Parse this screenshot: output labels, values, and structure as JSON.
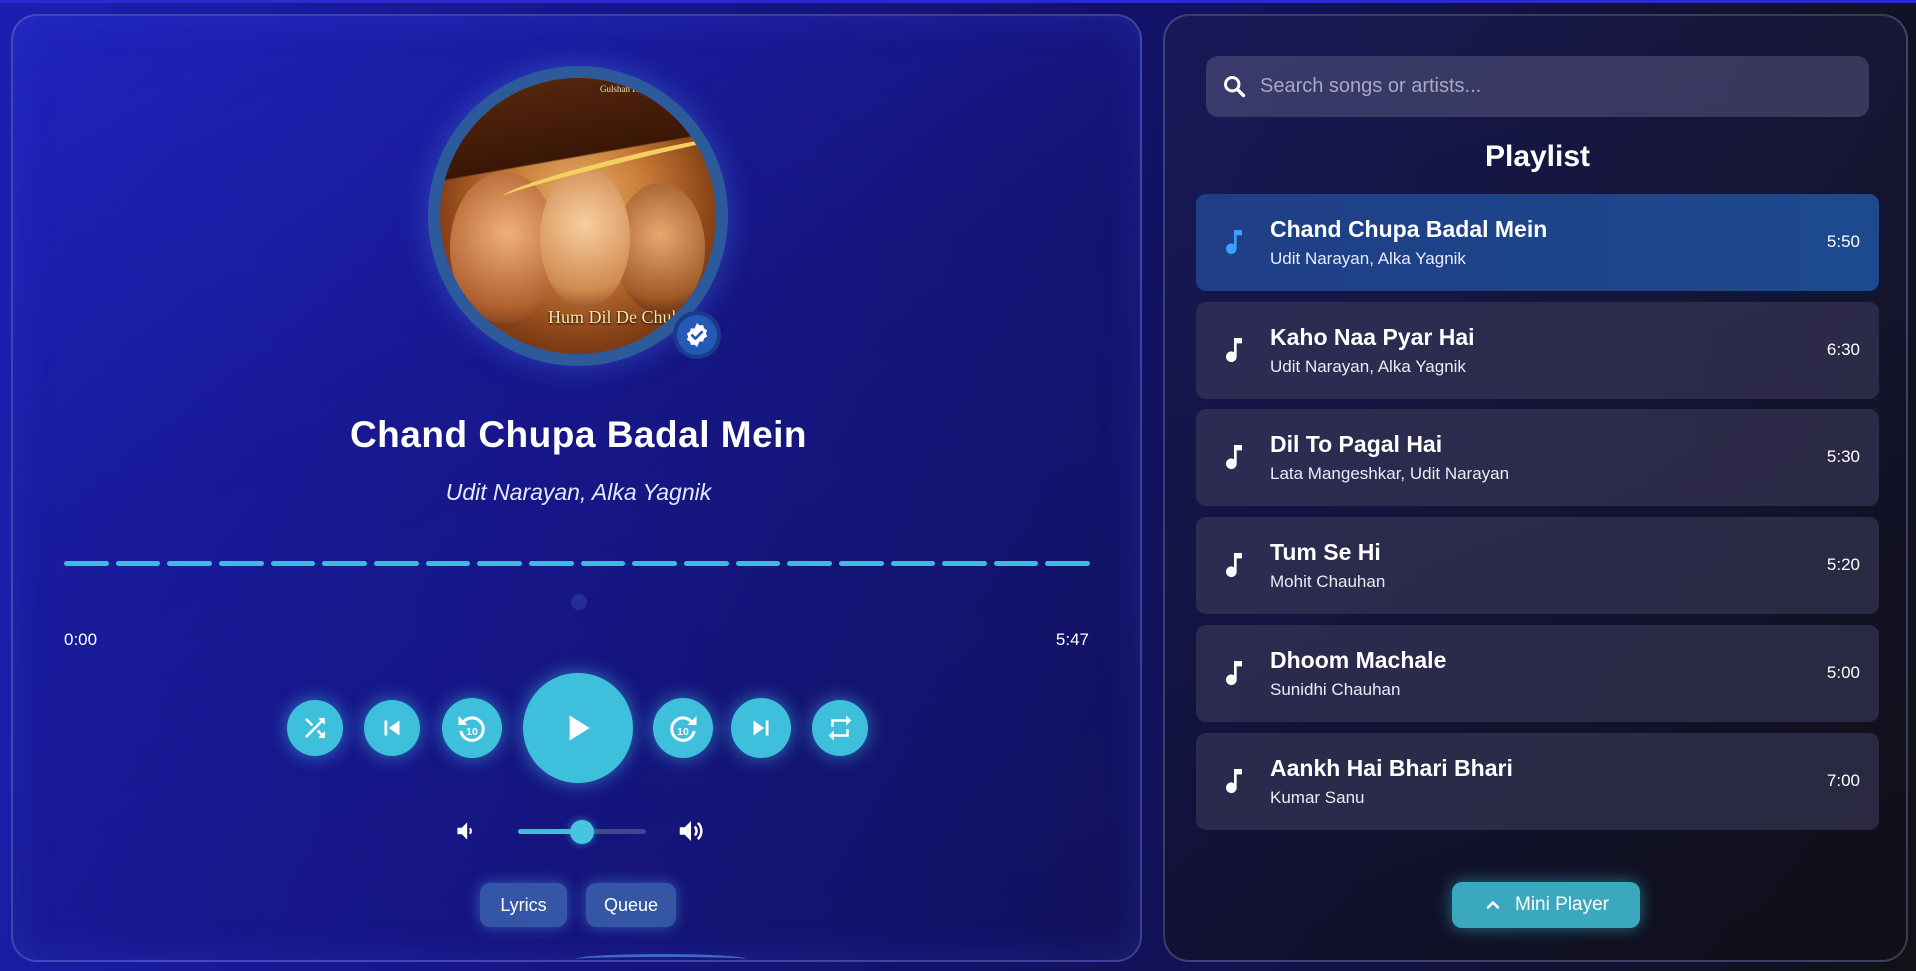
{
  "now_playing": {
    "title": "Chand Chupa Badal Mein",
    "artist": "Udit Narayan, Alka Yagnik",
    "album_art_text": "Hum Dil De Chuke",
    "album_art_top_text": "Gulshan K",
    "time_current": "0:00",
    "time_total": "5:47",
    "progress_fraction": 0,
    "volume_fraction": 0.5
  },
  "controls": {
    "shuffle": "shuffle-icon",
    "previous": "skip-previous-icon",
    "rewind": "replay-10-icon",
    "play": "play-icon",
    "forward": "forward-10-icon",
    "next": "skip-next-icon",
    "repeat": "repeat-icon"
  },
  "buttons": {
    "lyrics": "Lyrics",
    "queue": "Queue",
    "mini_player": "Mini Player"
  },
  "search": {
    "placeholder": "Search songs or artists...",
    "value": ""
  },
  "playlist": {
    "heading": "Playlist",
    "tracks": [
      {
        "title": "Chand Chupa Badal Mein",
        "artist": "Udit Narayan, Alka Yagnik",
        "duration": "5:50",
        "active": true
      },
      {
        "title": "Kaho Naa Pyar Hai",
        "artist": "Udit Narayan, Alka Yagnik",
        "duration": "6:30",
        "active": false
      },
      {
        "title": "Dil To Pagal Hai",
        "artist": "Lata Mangeshkar, Udit Narayan",
        "duration": "5:30",
        "active": false
      },
      {
        "title": "Tum Se Hi",
        "artist": "Mohit Chauhan",
        "duration": "5:20",
        "active": false
      },
      {
        "title": "Dhoom Machale",
        "artist": "Sunidhi Chauhan",
        "duration": "5:00",
        "active": false
      },
      {
        "title": "Aankh Hai Bhari Bhari",
        "artist": "Kumar Sanu",
        "duration": "7:00",
        "active": false
      }
    ]
  },
  "colors": {
    "accent": "#3ec0dc",
    "active_track": "#1f3e86",
    "active_note": "#3aa0ff"
  }
}
